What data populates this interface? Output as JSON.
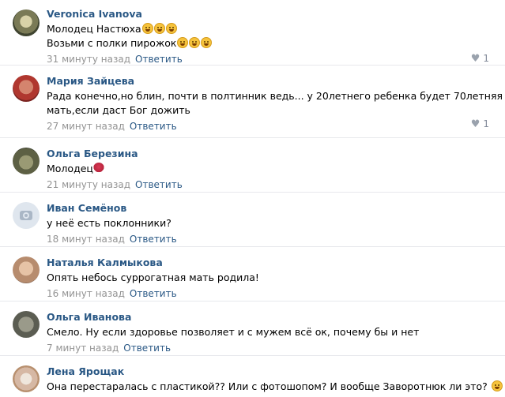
{
  "reply_label": "Ответить",
  "comments": [
    {
      "author": "Veronica Ivanova",
      "lines": [
        "Молодец Настюха",
        "Возьми с полки пирожок"
      ],
      "time": "31 минуту назад",
      "likes": "1"
    },
    {
      "author": "Мария Зайцева",
      "lines": [
        "Рада конечно,но блин, почти в полтинник ведь... у 20летнего ребенка будет 70летняя",
        "мать,если даст Бог дожить"
      ],
      "time": "27 минут назад",
      "likes": "1"
    },
    {
      "author": "Ольга Березина",
      "lines": [
        "Молодец"
      ],
      "time": "21 минуту назад",
      "likes": ""
    },
    {
      "author": "Иван Семёнов",
      "lines": [
        "у неё есть поклонники?"
      ],
      "time": "18 минут назад",
      "likes": ""
    },
    {
      "author": "Наталья Калмыкова",
      "lines": [
        "Опять небось суррогатная мать родила!"
      ],
      "time": "16 минут назад",
      "likes": ""
    },
    {
      "author": "Ольга Иванова",
      "lines": [
        "Смело. Ну если здоровье позволяет и с мужем всё ок, почему бы и нет"
      ],
      "time": "7 минут назад",
      "likes": ""
    },
    {
      "author": "Лена Ярощак",
      "lines": [
        "Она перестаралась с пластикой?? Или с фотошопом? И вообще Заворотнюк ли это?"
      ],
      "time": "",
      "likes": ""
    }
  ],
  "icons": {
    "like": "heart-icon",
    "camera": "camera-icon",
    "emoji": "laughing-emoji-icon",
    "rose": "rose-icon"
  },
  "colors": {
    "link": "#2a5885",
    "meta": "#939393",
    "divider": "#e7e8ec"
  }
}
